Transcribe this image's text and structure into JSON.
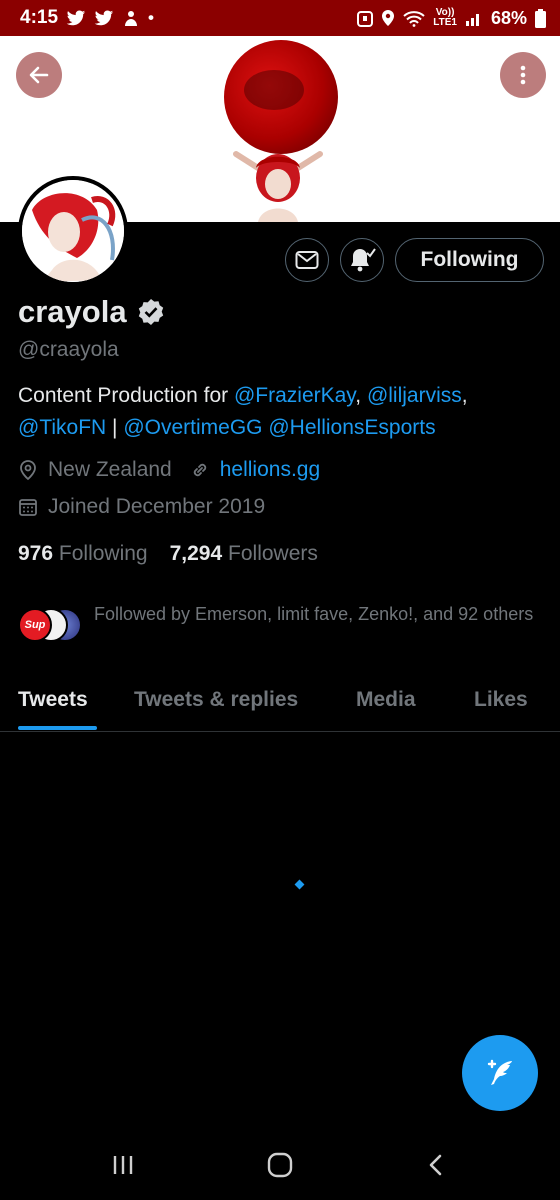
{
  "status_bar": {
    "time": "4:15",
    "battery": "68%",
    "network_label_top": "Vo))",
    "network_label_bottom": "LTE1"
  },
  "profile": {
    "display_name": "crayola",
    "handle": "@craayola",
    "following_button": "Following",
    "bio": {
      "prefix": "Content Production for ",
      "mention_1": "@FrazierKay",
      "sep_1": ", ",
      "mention_2": "@liljarviss",
      "sep_2": ",",
      "mention_3": "@TikoFN",
      "sep_3": " | ",
      "mention_4": "@OvertimeGG",
      "sep_4": " ",
      "mention_5": "@HellionsEsports"
    },
    "location": "New Zealand",
    "website": "hellions.gg",
    "joined": "Joined December 2019",
    "following_count": "976",
    "following_label": "Following",
    "followers_count": "7,294",
    "followers_label": "Followers",
    "followed_by": "Followed by Emerson, limit fave, Zenko!, and 92 others",
    "mini_avatar_text": "Sup"
  },
  "tabs": [
    {
      "label": "Tweets",
      "active": true
    },
    {
      "label": "Tweets & replies",
      "active": false
    },
    {
      "label": "Media",
      "active": false
    },
    {
      "label": "Likes",
      "active": false
    }
  ],
  "colors": {
    "accent": "#1d9bf0",
    "status_bar": "#8b0000",
    "background": "#000000"
  },
  "icons": {
    "back": "arrow-left-icon",
    "more": "more-vertical-icon",
    "mail": "mail-icon",
    "bell": "bell-check-icon",
    "verified": "verified-badge-icon",
    "location": "location-pin-icon",
    "link": "link-icon",
    "calendar": "calendar-icon",
    "compose": "compose-feather-icon"
  }
}
